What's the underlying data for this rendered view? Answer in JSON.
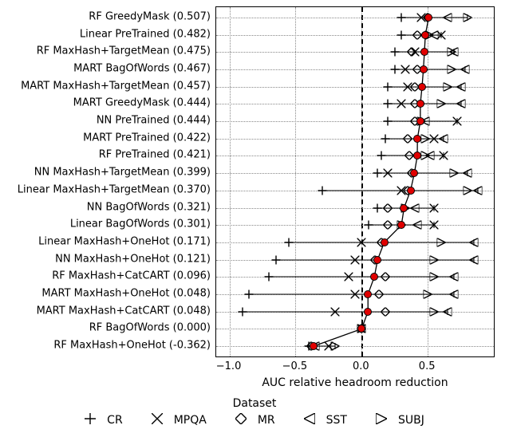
{
  "chart_data": {
    "type": "dot-plot-multi-marker",
    "xlabel": "AUC relative headroom reduction",
    "ylabel": "",
    "xlim": [
      -1.1,
      1.0
    ],
    "x_ticks": [
      -1.0,
      -0.5,
      0.0,
      0.5
    ],
    "legend_title": "Dataset",
    "legend": [
      {
        "name": "CR",
        "marker": "plus"
      },
      {
        "name": "MPQA",
        "marker": "x"
      },
      {
        "name": "MR",
        "marker": "diamond"
      },
      {
        "name": "SST",
        "marker": "tri-left"
      },
      {
        "name": "SUBJ",
        "marker": "tri-right"
      }
    ],
    "rows": [
      {
        "label": "RF GreedyMask (0.507)",
        "mean": 0.507,
        "err_lo": 0.3,
        "err_hi": 0.8,
        "points": {
          "CR": 0.3,
          "MPQA": 0.45,
          "MR": 0.5,
          "SST": 0.65,
          "SUBJ": 0.8
        }
      },
      {
        "label": "Linear PreTrained (0.482)",
        "mean": 0.482,
        "err_lo": 0.3,
        "err_hi": 0.6,
        "points": {
          "CR": 0.3,
          "MPQA": 0.6,
          "MR": 0.42,
          "SST": 0.55,
          "SUBJ": 0.51
        }
      },
      {
        "label": "RF MaxHash+TargetMean (0.475)",
        "mean": 0.475,
        "err_lo": 0.25,
        "err_hi": 0.7,
        "points": {
          "CR": 0.25,
          "MPQA": 0.4,
          "MR": 0.38,
          "SST": 0.7,
          "SUBJ": 0.68
        }
      },
      {
        "label": "MART BagOfWords (0.467)",
        "mean": 0.467,
        "err_lo": 0.25,
        "err_hi": 0.78,
        "points": {
          "CR": 0.25,
          "MPQA": 0.33,
          "MR": 0.42,
          "SST": 0.78,
          "SUBJ": 0.68
        }
      },
      {
        "label": "MART MaxHash+TargetMean (0.457)",
        "mean": 0.457,
        "err_lo": 0.2,
        "err_hi": 0.75,
        "points": {
          "CR": 0.2,
          "MPQA": 0.35,
          "MR": 0.4,
          "SST": 0.75,
          "SUBJ": 0.65
        }
      },
      {
        "label": "MART GreedyMask (0.444)",
        "mean": 0.444,
        "err_lo": 0.2,
        "err_hi": 0.75,
        "points": {
          "CR": 0.2,
          "MPQA": 0.3,
          "MR": 0.4,
          "SST": 0.75,
          "SUBJ": 0.6
        }
      },
      {
        "label": "NN PreTrained (0.444)",
        "mean": 0.444,
        "err_lo": 0.2,
        "err_hi": 0.72,
        "points": {
          "CR": 0.2,
          "MPQA": 0.72,
          "MR": 0.4,
          "SST": 0.48,
          "SUBJ": 0.45
        }
      },
      {
        "label": "MART PreTrained (0.422)",
        "mean": 0.422,
        "err_lo": 0.18,
        "err_hi": 0.62,
        "points": {
          "CR": 0.18,
          "MPQA": 0.55,
          "MR": 0.35,
          "SST": 0.62,
          "SUBJ": 0.48
        }
      },
      {
        "label": "RF PreTrained (0.421)",
        "mean": 0.421,
        "err_lo": 0.15,
        "err_hi": 0.62,
        "points": {
          "CR": 0.15,
          "MPQA": 0.62,
          "MR": 0.36,
          "SST": 0.52,
          "SUBJ": 0.48
        }
      },
      {
        "label": "NN MaxHash+TargetMean (0.399)",
        "mean": 0.399,
        "err_lo": 0.12,
        "err_hi": 0.8,
        "points": {
          "CR": 0.12,
          "MPQA": 0.2,
          "MR": 0.38,
          "SST": 0.8,
          "SUBJ": 0.7
        }
      },
      {
        "label": "Linear MaxHash+TargetMean (0.370)",
        "mean": 0.37,
        "err_lo": -0.3,
        "err_hi": 0.88,
        "points": {
          "CR": -0.3,
          "MPQA": 0.3,
          "MR": 0.35,
          "SST": 0.88,
          "SUBJ": 0.8
        }
      },
      {
        "label": "NN BagOfWords (0.321)",
        "mean": 0.321,
        "err_lo": 0.12,
        "err_hi": 0.55,
        "points": {
          "CR": 0.12,
          "MPQA": 0.55,
          "MR": 0.2,
          "SST": 0.4,
          "SUBJ": 0.33
        }
      },
      {
        "label": "Linear BagOfWords (0.301)",
        "mean": 0.301,
        "err_lo": 0.05,
        "err_hi": 0.55,
        "points": {
          "CR": 0.05,
          "MPQA": 0.55,
          "MR": 0.2,
          "SST": 0.42,
          "SUBJ": 0.3
        }
      },
      {
        "label": "Linear MaxHash+OneHot (0.171)",
        "mean": 0.171,
        "err_lo": -0.55,
        "err_hi": 0.85,
        "points": {
          "CR": -0.55,
          "MPQA": 0.0,
          "MR": 0.15,
          "SST": 0.85,
          "SUBJ": 0.6
        }
      },
      {
        "label": "NN MaxHash+OneHot (0.121)",
        "mean": 0.121,
        "err_lo": -0.65,
        "err_hi": 0.85,
        "points": {
          "CR": -0.65,
          "MPQA": -0.05,
          "MR": 0.1,
          "SST": 0.85,
          "SUBJ": 0.55
        }
      },
      {
        "label": "RF MaxHash+CatCART (0.096)",
        "mean": 0.096,
        "err_lo": -0.7,
        "err_hi": 0.7,
        "points": {
          "CR": -0.7,
          "MPQA": -0.1,
          "MR": 0.18,
          "SST": 0.7,
          "SUBJ": 0.55
        }
      },
      {
        "label": "MART MaxHash+OneHot (0.048)",
        "mean": 0.048,
        "err_lo": -0.85,
        "err_hi": 0.7,
        "points": {
          "CR": -0.85,
          "MPQA": -0.05,
          "MR": 0.13,
          "SST": 0.7,
          "SUBJ": 0.5
        }
      },
      {
        "label": "MART MaxHash+CatCART (0.048)",
        "mean": 0.048,
        "err_lo": -0.9,
        "err_hi": 0.65,
        "points": {
          "CR": -0.9,
          "MPQA": -0.2,
          "MR": 0.18,
          "SST": 0.65,
          "SUBJ": 0.55
        }
      },
      {
        "label": "RF BagOfWords (0.000)",
        "mean": 0.0,
        "err_lo": 0.0,
        "err_hi": 0.0,
        "points": {
          "CR": 0.0,
          "MPQA": 0.0,
          "MR": 0.0,
          "SST": 0.0,
          "SUBJ": 0.0
        }
      },
      {
        "label": "RF MaxHash+OneHot (-0.362)",
        "mean": -0.362,
        "err_lo": -0.4,
        "err_hi": -0.2,
        "points": {
          "CR": -0.4,
          "MPQA": -0.25,
          "MR": -0.38,
          "SST": -0.35,
          "SUBJ": -0.2
        }
      }
    ]
  }
}
